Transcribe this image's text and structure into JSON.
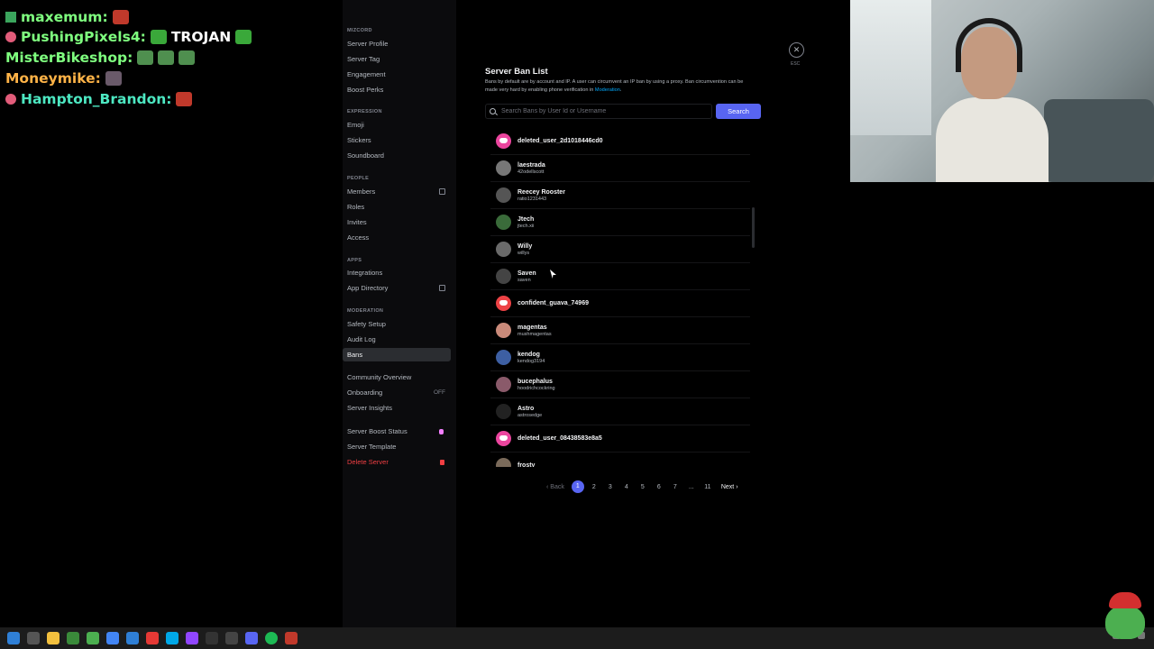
{
  "chat": {
    "lines": [
      {
        "user": "maxemum:",
        "color": "#7fff7f"
      },
      {
        "user": "PushingPixels4:",
        "color": "#7fff7f",
        "message": "TROJAN"
      },
      {
        "user": "MisterBikeshop:",
        "color": "#7fff7f"
      },
      {
        "user": "Moneymike:",
        "color": "#ffb347"
      },
      {
        "user": "Hampton_Brandon:",
        "color": "#4de8c2"
      }
    ]
  },
  "sidebar": {
    "server_name": "MIZCORD",
    "items_top": [
      "Server Profile",
      "Server Tag",
      "Engagement",
      "Boost Perks"
    ],
    "section_expression": "EXPRESSION",
    "items_expression": [
      "Emoji",
      "Stickers",
      "Soundboard"
    ],
    "section_people": "PEOPLE",
    "items_people": [
      "Members",
      "Roles",
      "Invites",
      "Access"
    ],
    "section_apps": "APPS",
    "items_apps": [
      "Integrations",
      "App Directory"
    ],
    "section_moderation": "MODERATION",
    "items_moderation": [
      "Safety Setup",
      "Audit Log",
      "Bans"
    ],
    "items_community": [
      "Community Overview",
      "Onboarding",
      "Server Insights"
    ],
    "onboarding_status": "OFF",
    "items_bottom": [
      "Server Boost Status",
      "Server Template"
    ],
    "delete_label": "Delete Server"
  },
  "main": {
    "title": "Server Ban List",
    "description": "Bans by default are by account and IP. A user can circumvent an IP ban by using a proxy. Ban circumvention can be made very hard by enabling phone verification in",
    "description_link": "Moderation",
    "description_end": ".",
    "search_placeholder": "Search Bans by User Id or Username",
    "search_button": "Search",
    "close_hint": "ESC",
    "bans": [
      {
        "display": "deleted_user_2d1018446cd0",
        "username": "",
        "avatar": "discord-purple"
      },
      {
        "display": "laestrada",
        "username": "42odellscott",
        "avatar": "#777"
      },
      {
        "display": "Reecey Rooster",
        "username": "ratio1231443",
        "avatar": "#555"
      },
      {
        "display": "Jtech",
        "username": "jtech.xii",
        "avatar": "#3a6b3a"
      },
      {
        "display": "Willy",
        "username": "willys",
        "avatar": "#6a6a6a"
      },
      {
        "display": "Saven",
        "username": "saven",
        "avatar": "#444"
      },
      {
        "display": "confident_guava_74969",
        "username": "",
        "avatar": "discord"
      },
      {
        "display": "magentas",
        "username": "mushmagentas",
        "avatar": "#c98a7a"
      },
      {
        "display": "kendog",
        "username": "kendog3194",
        "avatar": "#3d5fa3"
      },
      {
        "display": "bucephalus",
        "username": "hoodrichcockring",
        "avatar": "#8a5a6a"
      },
      {
        "display": "Astro",
        "username": "astrosedge",
        "avatar": "#222"
      },
      {
        "display": "deleted_user_08438583e8a5",
        "username": "",
        "avatar": "discord-purple"
      },
      {
        "display": "frosty",
        "username": "",
        "avatar": "#7a6a5a"
      }
    ],
    "pagination": {
      "back": "Back",
      "pages": [
        "1",
        "2",
        "3",
        "4",
        "5",
        "6",
        "7",
        "...",
        "11"
      ],
      "current": "1",
      "next": "Next"
    }
  },
  "colors": {
    "accent": "#5865f2",
    "danger": "#f23f43"
  }
}
